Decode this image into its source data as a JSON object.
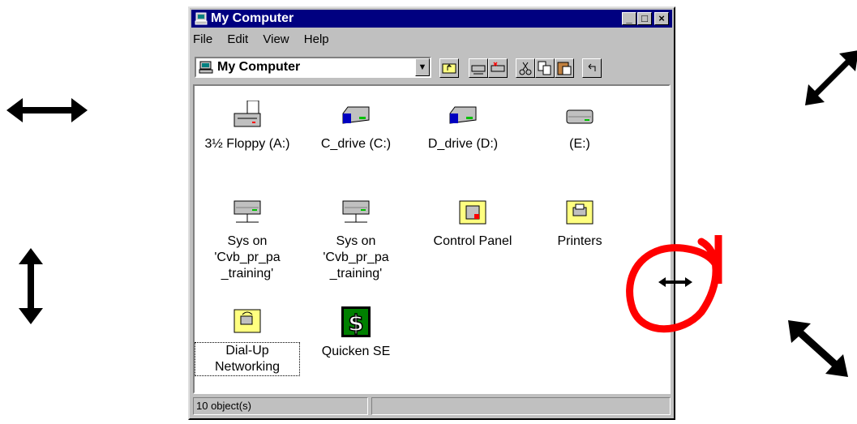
{
  "window": {
    "title": "My Computer",
    "buttons": {
      "minimize": "_",
      "maximize": "□",
      "close": "×"
    }
  },
  "menu": {
    "items": [
      "File",
      "Edit",
      "View",
      "Help"
    ]
  },
  "address": {
    "value": "My Computer"
  },
  "items": [
    {
      "label": "3½ Floppy (A:)",
      "icon": "floppy-drive-icon"
    },
    {
      "label": "C_drive (C:)",
      "icon": "hard-drive-icon"
    },
    {
      "label": "D_drive (D:)",
      "icon": "hard-drive-icon"
    },
    {
      "label": "(E:)",
      "icon": "removable-drive-icon"
    },
    {
      "label": "Sys on 'Cvb_pr_pa _training'",
      "icon": "network-drive-icon"
    },
    {
      "label": "Sys on 'Cvb_pr_pa _training'",
      "icon": "network-drive-icon"
    },
    {
      "label": "Control Panel",
      "icon": "control-panel-folder-icon"
    },
    {
      "label": "Printers",
      "icon": "printers-folder-icon"
    },
    {
      "label": "Dial-Up Networking",
      "icon": "dialup-folder-icon"
    },
    {
      "label": "Quicken SE",
      "icon": "quicken-icon"
    }
  ],
  "status": {
    "objects": "10 object(s)"
  }
}
